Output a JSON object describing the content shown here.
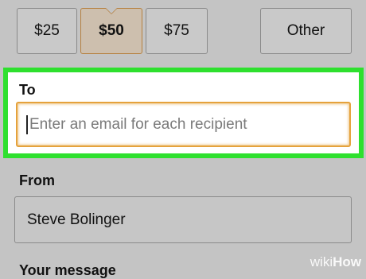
{
  "amounts": {
    "options": [
      "$25",
      "$50",
      "$75"
    ],
    "other_label": "Other",
    "selected": "$50"
  },
  "to_section": {
    "label": "To",
    "placeholder": "Enter an email for each recipient"
  },
  "from_section": {
    "label": "From",
    "value": "Steve Bolinger"
  },
  "message_section": {
    "label": "Your message"
  },
  "watermark": {
    "prefix": "wiki",
    "suffix": "How"
  },
  "colors": {
    "highlight": "#2ee02e",
    "focus_border": "#e5a23c",
    "selected_border": "#b6803e"
  }
}
